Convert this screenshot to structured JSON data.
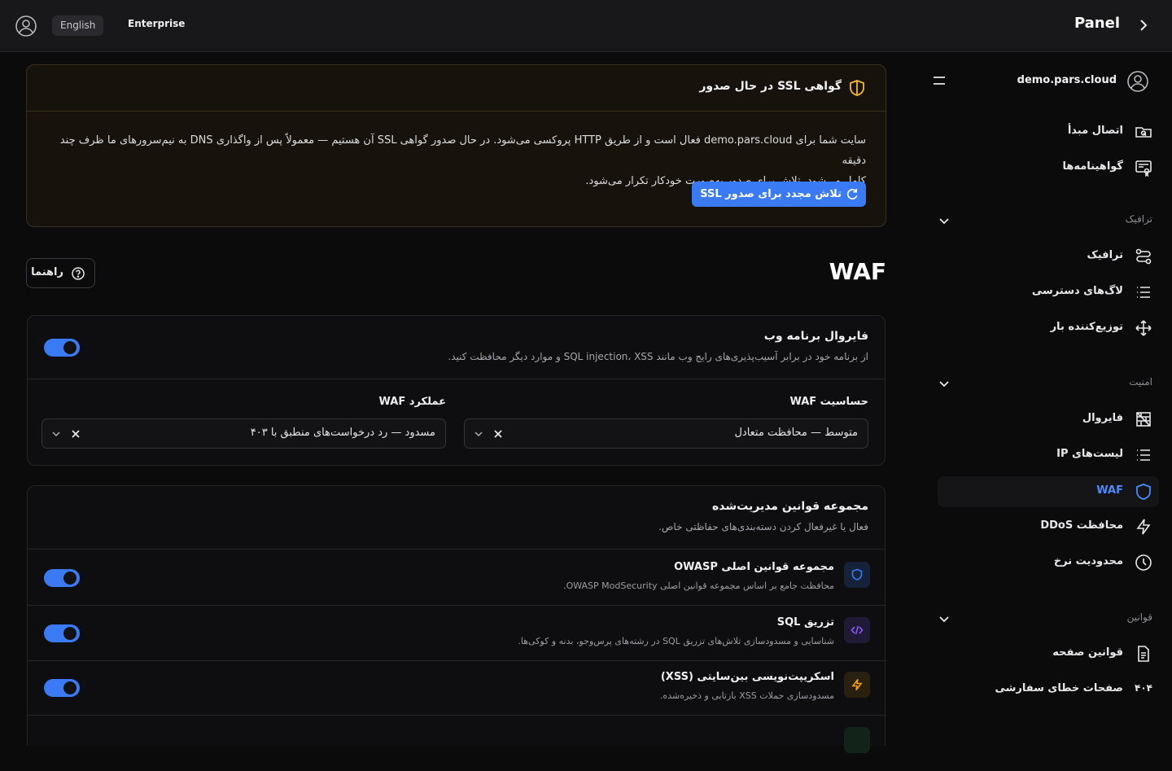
{
  "topbar": {
    "language": "English",
    "plan": "Enterprise",
    "title": "Panel"
  },
  "sidebar": {
    "domain": "demo.pars.cloud",
    "items_top": [
      {
        "label": "اتصال مبدأ",
        "icon": "folder-link-icon"
      },
      {
        "label": "گواهینامه‌ها",
        "icon": "certificate-icon"
      }
    ],
    "sections": {
      "traffic": "ترافیک",
      "security": "امنیت",
      "rules": "قوانین"
    },
    "traffic_items": [
      {
        "label": "ترافیک",
        "icon": "route-icon"
      },
      {
        "label": "لاگ‌های دسترسی",
        "icon": "list-icon"
      },
      {
        "label": "توزیع‌کننده بار",
        "icon": "load-balancer-icon"
      }
    ],
    "security_items": [
      {
        "label": "فایروال",
        "icon": "firewall-icon"
      },
      {
        "label": "لیست‌های IP",
        "icon": "list-icon"
      },
      {
        "label": "WAF",
        "icon": "shield-icon",
        "active": true
      },
      {
        "label": "محافظت DDoS",
        "icon": "bolt-icon"
      },
      {
        "label": "محدودیت نرخ",
        "icon": "clock-icon"
      }
    ],
    "rules_items": [
      {
        "label": "قوانین صفحه",
        "icon": "file-icon"
      },
      {
        "label": "صفحات خطای سفارشی",
        "icon": "404-icon",
        "glyph": "۴۰۴"
      }
    ]
  },
  "ssl_banner": {
    "title": "گواهی SSL در حال صدور",
    "body_line1": "سایت شما برای demo.pars.cloud فعال است و از طریق HTTP پروکسی می‌شود. در حال صدور گواهی SSL آن هستیم — معمولاً پس از واگذاری DNS به نیم‌سرورهای ما ظرف چند دقیقه",
    "body_line2": "کامل می‌شود. تلاش برای صدور به‌صورت خودکار تکرار می‌شود.",
    "retry_button": "تلاش مجدد برای صدور SSL"
  },
  "page": {
    "title": "WAF",
    "help_button": "راهنما"
  },
  "waf_card": {
    "title": "فایروال برنامه وب",
    "description": "از برنامه خود در برابر آسیب‌پذیری‌های رایج وب مانند SQL injection، XSS و موارد دیگر محافظت کنید.",
    "enabled": true,
    "sensitivity": {
      "label": "حساسیت WAF",
      "value": "متوسط — محافظت متعادل"
    },
    "action": {
      "label": "عملکرد WAF",
      "value": "مسدود — رد درخواست‌های منطبق با ۴۰۳"
    }
  },
  "rulesets": {
    "title": "مجموعه قوانین مدیریت‌شده",
    "description": "فعال یا غیرفعال کردن دسته‌بندی‌های حفاظتی خاص.",
    "items": [
      {
        "title": "مجموعه قوانین اصلی OWASP",
        "description": "محافظت جامع بر اساس مجموعه قوانین اصلی OWASP ModSecurity.",
        "icon": "shield-icon",
        "color": "#3a7bf5",
        "enabled": true
      },
      {
        "title": "تزریق SQL",
        "description": "شناسایی و مسدودسازی تلاش‌های تزریق SQL در رشته‌های پرس‌وجو، بدنه و کوکی‌ها.",
        "icon": "code-icon",
        "color": "#8b5cf6",
        "enabled": true
      },
      {
        "title": "اسکریپت‌نویسی بین‌سایتی (XSS)",
        "description": "مسدودسازی حملات XSS بازتابی و ذخیره‌شده.",
        "icon": "bolt-icon",
        "color": "#f59e0b",
        "enabled": true
      }
    ]
  }
}
